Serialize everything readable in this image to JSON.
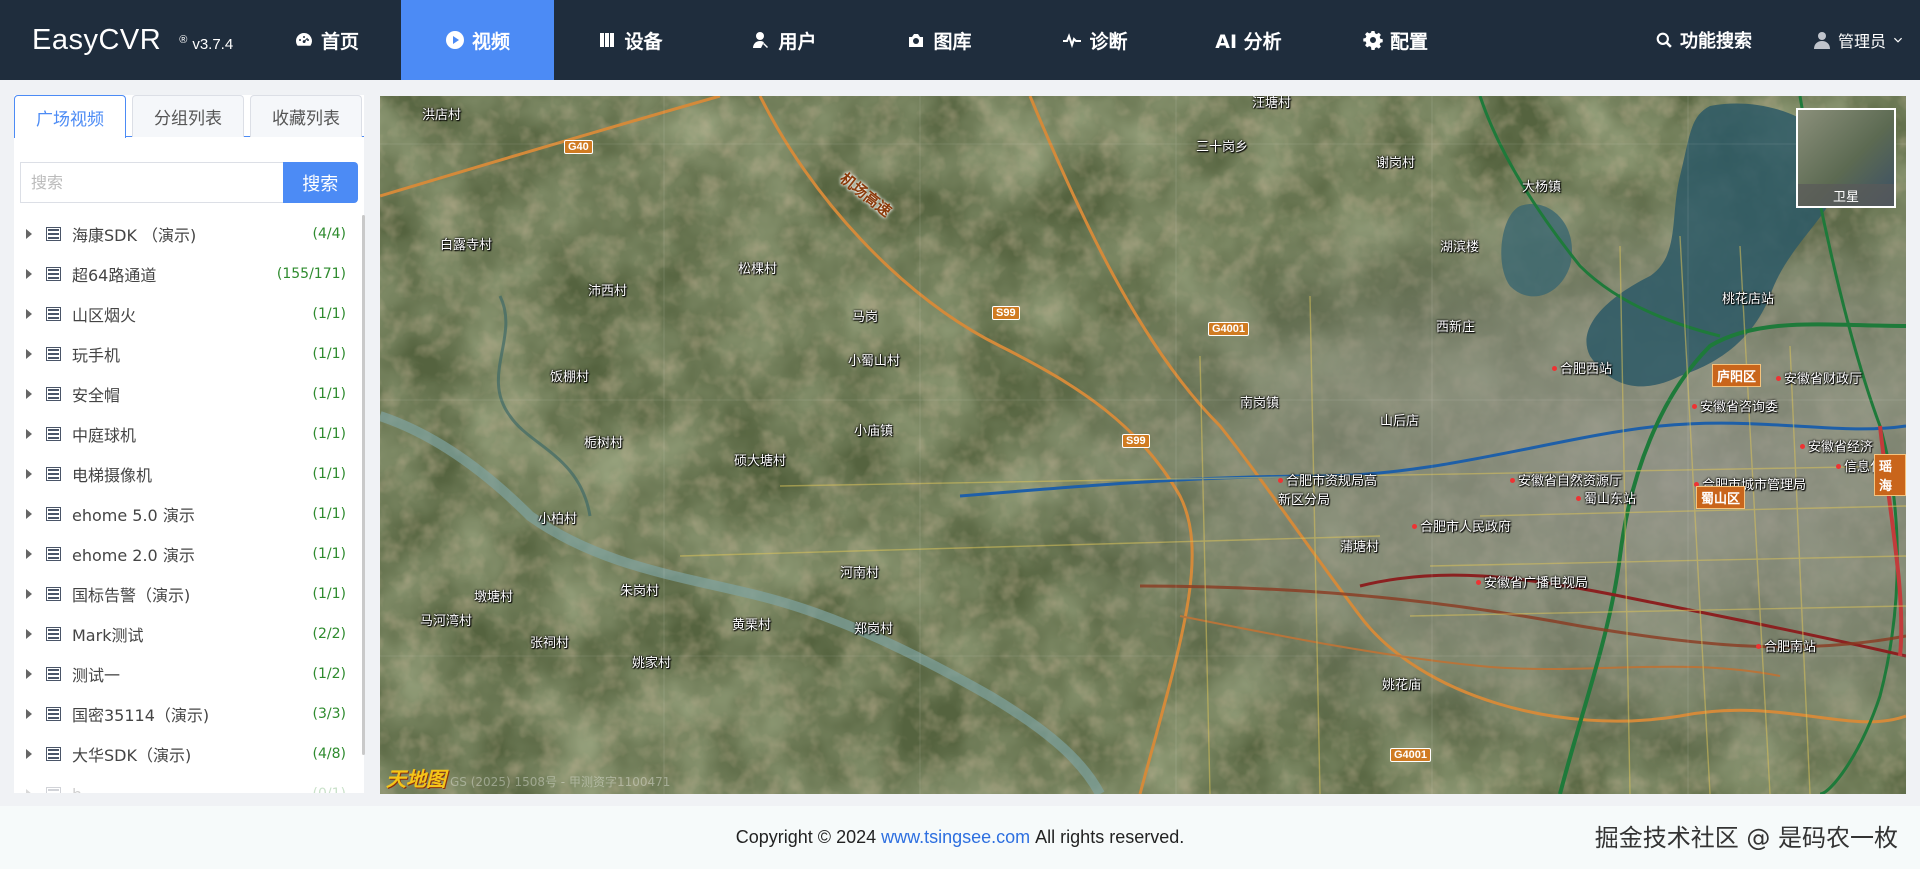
{
  "app": {
    "name": "EasyCVR",
    "version": "v3.7.4",
    "reg": "®"
  },
  "nav": {
    "items": [
      {
        "label": "首页",
        "icon": "dashboard-icon"
      },
      {
        "label": "视频",
        "icon": "play-circle-icon",
        "active": true
      },
      {
        "label": "设备",
        "icon": "device-icon"
      },
      {
        "label": "用户",
        "icon": "user-icon"
      },
      {
        "label": "图库",
        "icon": "camera-icon"
      },
      {
        "label": "诊断",
        "icon": "pulse-icon"
      },
      {
        "label": "AI 分析",
        "icon": ""
      },
      {
        "label": "配置",
        "icon": "gear-icon"
      }
    ],
    "search_label": "功能搜索",
    "user_label": "管理员"
  },
  "left": {
    "tabs": [
      "广场视频",
      "分组列表",
      "收藏列表"
    ],
    "search_placeholder": "搜索",
    "search_button": "搜索",
    "tree": [
      {
        "label": "海康SDK （演示)",
        "count": "(4/4)"
      },
      {
        "label": "超64路通道",
        "count": "(155/171)"
      },
      {
        "label": "山区烟火",
        "count": "(1/1)"
      },
      {
        "label": "玩手机",
        "count": "(1/1)"
      },
      {
        "label": "安全帽",
        "count": "(1/1)"
      },
      {
        "label": "中庭球机",
        "count": "(1/1)"
      },
      {
        "label": "电梯摄像机",
        "count": "(1/1)"
      },
      {
        "label": "ehome 5.0 演示",
        "count": "(1/1)"
      },
      {
        "label": "ehome 2.0 演示",
        "count": "(1/1)"
      },
      {
        "label": "国标告警（演示)",
        "count": "(1/1)"
      },
      {
        "label": "Mark测试",
        "count": "(2/2)"
      },
      {
        "label": "测试一",
        "count": "(1/2)"
      },
      {
        "label": "国密35114（演示)",
        "count": "(3/3)"
      },
      {
        "label": "大华SDK（演示)",
        "count": "(4/8)"
      },
      {
        "label": "h...",
        "count": "(0/1)"
      }
    ]
  },
  "map": {
    "minimap_label": "卫星",
    "logo": "天地图",
    "copyright": "GS (2025) 1508号 - 甲测资字1100471",
    "places": [
      {
        "t": "洪店村"
      },
      {
        "t": "汪塘村"
      },
      {
        "t": "三十岗乡"
      },
      {
        "t": "谢岗村"
      },
      {
        "t": "大杨镇"
      },
      {
        "t": "白露寺村"
      },
      {
        "t": "松棵村"
      },
      {
        "t": "湖滨楼"
      },
      {
        "t": "沛西村"
      },
      {
        "t": "马岗"
      },
      {
        "t": "西新庄"
      },
      {
        "t": "小蜀山村"
      },
      {
        "t": "饭棚村"
      },
      {
        "t": "南岗镇"
      },
      {
        "t": "山后店"
      },
      {
        "t": "栀树村"
      },
      {
        "t": "小庙镇"
      },
      {
        "t": "硕大塘村"
      },
      {
        "t": "合肥市资规局高新区分局"
      },
      {
        "t": "小柏村"
      },
      {
        "t": "蒲塘村"
      },
      {
        "t": "合肥市人民政府"
      },
      {
        "t": "河南村"
      },
      {
        "t": "墩塘村"
      },
      {
        "t": "朱岗村"
      },
      {
        "t": "马河湾村"
      },
      {
        "t": "安徽省广播电视局"
      },
      {
        "t": "黄栗村"
      },
      {
        "t": "郑岗村"
      },
      {
        "t": "张祠村"
      },
      {
        "t": "姚家村"
      },
      {
        "t": "姚花庙"
      },
      {
        "t": "桃花店站"
      },
      {
        "t": "合肥西站"
      },
      {
        "t": "安徽省财政厅"
      },
      {
        "t": "安徽省咨询委"
      },
      {
        "t": "安徽省经济"
      },
      {
        "t": "信息化厅"
      },
      {
        "t": "安徽省自然资源厅"
      },
      {
        "t": "合肥市城市管理局"
      },
      {
        "t": "蜀山东站"
      },
      {
        "t": "合肥南站"
      }
    ],
    "roads": [
      "G40",
      "S99",
      "G4001",
      "S99",
      "G4001"
    ],
    "districts": [
      "庐阳区",
      "蜀山区",
      "瑶海"
    ],
    "highway_label": "机场高速"
  },
  "footer": {
    "prefix": "Copyright © 2024",
    "link": "www.tsingsee.com",
    "suffix": "All rights reserved."
  },
  "watermark": "掘金技术社区 @ 是码农一枚"
}
